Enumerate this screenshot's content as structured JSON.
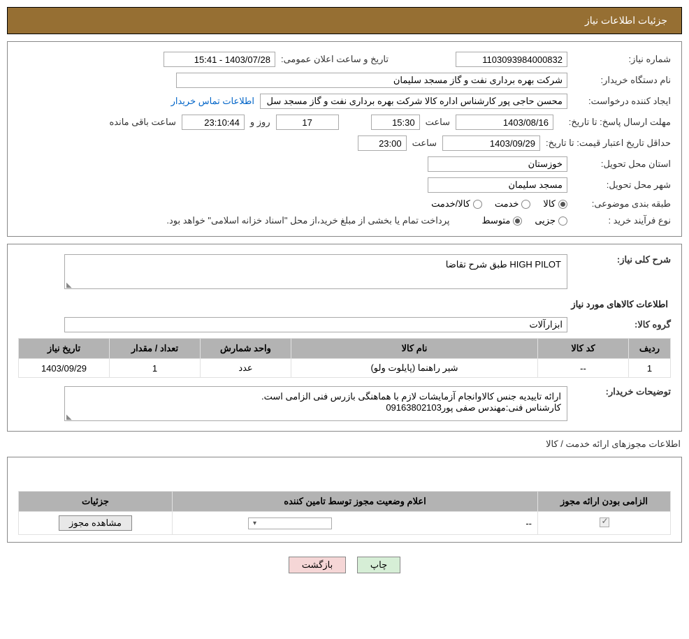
{
  "page_title": "جزئیات اطلاعات نیاز",
  "labels": {
    "need_number": "شماره نیاز:",
    "announce_date": "تاریخ و ساعت اعلان عمومی:",
    "buyer_org": "نام دستگاه خریدار:",
    "requester": "ایجاد کننده درخواست:",
    "buyer_contact": "اطلاعات تماس خریدار",
    "response_deadline": "مهلت ارسال پاسخ: تا تاریخ:",
    "time": "ساعت",
    "days_and": "روز و",
    "hours_remain": "ساعت باقی مانده",
    "price_validity": "حداقل تاریخ اعتبار قیمت: تا تاریخ:",
    "delivery_province": "استان محل تحویل:",
    "delivery_city": "شهر محل تحویل:",
    "subject_class": "طبقه بندی موضوعی:",
    "purchase_process": "نوع فرآیند خرید :",
    "goods_opt": "کالا",
    "service_opt": "خدمت",
    "goods_service_opt": "کالا/خدمت",
    "partial_opt": "جزیی",
    "medium_opt": "متوسط",
    "payment_note": "پرداخت تمام یا بخشی از مبلغ خرید،از محل \"اسناد خزانه اسلامی\" خواهد بود.",
    "general_desc": "شرح کلی نیاز:",
    "goods_info_heading": "اطلاعات کالاهای مورد نیاز",
    "goods_group": "گروه کالا:",
    "buyer_notes": "توضیحات خریدار:",
    "license_section": "اطلاعات مجوزهای ارائه خدمت / کالا"
  },
  "values": {
    "need_number": "1103093984000832",
    "announce_date": "1403/07/28 - 15:41",
    "buyer_org": "شرکت بهره برداری نفت و گاز مسجد سلیمان",
    "requester": "محسن حاجی پور کارشناس اداره کالا  شرکت بهره برداری نفت و گاز مسجد سل",
    "response_date": "1403/08/16",
    "response_time": "15:30",
    "days_remain": "17",
    "countdown": "23:10:44",
    "price_validity_date": "1403/09/29",
    "price_validity_time": "23:00",
    "province": "خوزستان",
    "city": "مسجد سلیمان",
    "general_desc": "HIGH PILOT  طبق شرح تقاضا",
    "goods_group": "ابزارآلات",
    "buyer_notes_line1": "ارائه تاییدیه جنس کالاوانجام آزمایشات لازم با هماهنگی بازرس فنی الزامی است.",
    "buyer_notes_line2": "کارشناس فنی:مهندس صفی پور09163802103"
  },
  "goods_table": {
    "headers": {
      "row": "ردیف",
      "code": "کد کالا",
      "name": "نام کالا",
      "unit": "واحد شمارش",
      "qty": "تعداد / مقدار",
      "need_date": "تاریخ نیاز"
    },
    "rows": [
      {
        "row": "1",
        "code": "--",
        "name": "شیر راهنما (پایلوت ولو)",
        "unit": "عدد",
        "qty": "1",
        "need_date": "1403/09/29"
      }
    ]
  },
  "perm_table": {
    "headers": {
      "mandatory": "الزامی بودن ارائه مجوز",
      "status": "اعلام وضعیت مجوز توسط تامین کننده",
      "details": "جزئیات"
    },
    "status_placeholder": "--",
    "view_btn": "مشاهده مجوز"
  },
  "buttons": {
    "print": "چاپ",
    "back": "بازگشت"
  }
}
